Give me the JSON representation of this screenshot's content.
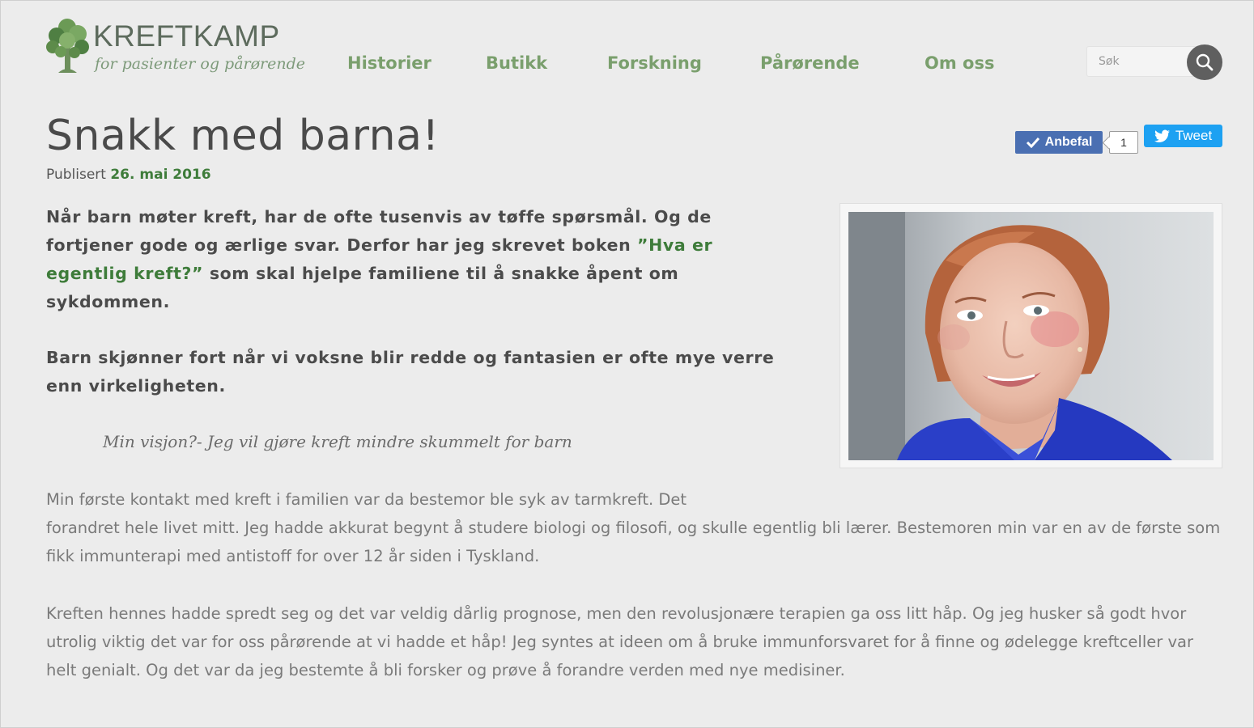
{
  "site": {
    "name": "KREFTKAMP",
    "tagline": "for pasienter og pårørende"
  },
  "nav": {
    "items": [
      "Historier",
      "Butikk",
      "Forskning",
      "Pårørende",
      "Om oss"
    ]
  },
  "search": {
    "placeholder": "Søk"
  },
  "article": {
    "title": "Snakk med barna!",
    "published_label": "Publisert",
    "published_date": "26. mai 2016",
    "lead1_start": "Når barn møter kreft, har de ofte tusenvis av tøffe spørsmål. Og de fortjener gode og ærlige svar.  Derfor har jeg skrevet boken ",
    "lead1_link": "”Hva er egentlig kreft?”",
    "lead1_end": " som skal hjelpe familiene til å snakke åpent om sykdommen.",
    "lead2": "Barn skjønner fort når vi voksne blir redde og fantasien er ofte mye verre enn virkeligheten.",
    "quote": "Min visjon?- Jeg vil gjøre kreft mindre skummelt for barn",
    "body1_line1": "Min første kontakt med kreft i familien var da bestemor ble syk av tarmkreft. Det",
    "body1_rest": "forandret hele livet mitt. Jeg hadde akkurat begynt å studere biologi og filosofi, og skulle egentlig bli lærer. Bestemoren min var en av de første som fikk immunterapi med antistoff for over 12 år siden i Tyskland.",
    "body2": "Kreften hennes hadde spredt seg og det var veldig dårlig prognose, men den revolusjonære terapien ga oss litt håp. Og jeg husker så godt hvor utrolig viktig det var for oss pårørende at vi hadde et håp! Jeg syntes at ideen om å bruke immunforsvaret for å finne og ødelegge kreftceller var helt genialt. Og det var da jeg bestemte å bli forsker og prøve å forandre verden med nye medisiner."
  },
  "social": {
    "recommend_label": "Anbefal",
    "recommend_count": "1",
    "tweet_label": "Tweet"
  },
  "colors": {
    "accent_green": "#3e7c3a",
    "nav_green": "#7a9f6d",
    "facebook_blue": "#4a6fb2",
    "twitter_blue": "#1da1f2"
  }
}
